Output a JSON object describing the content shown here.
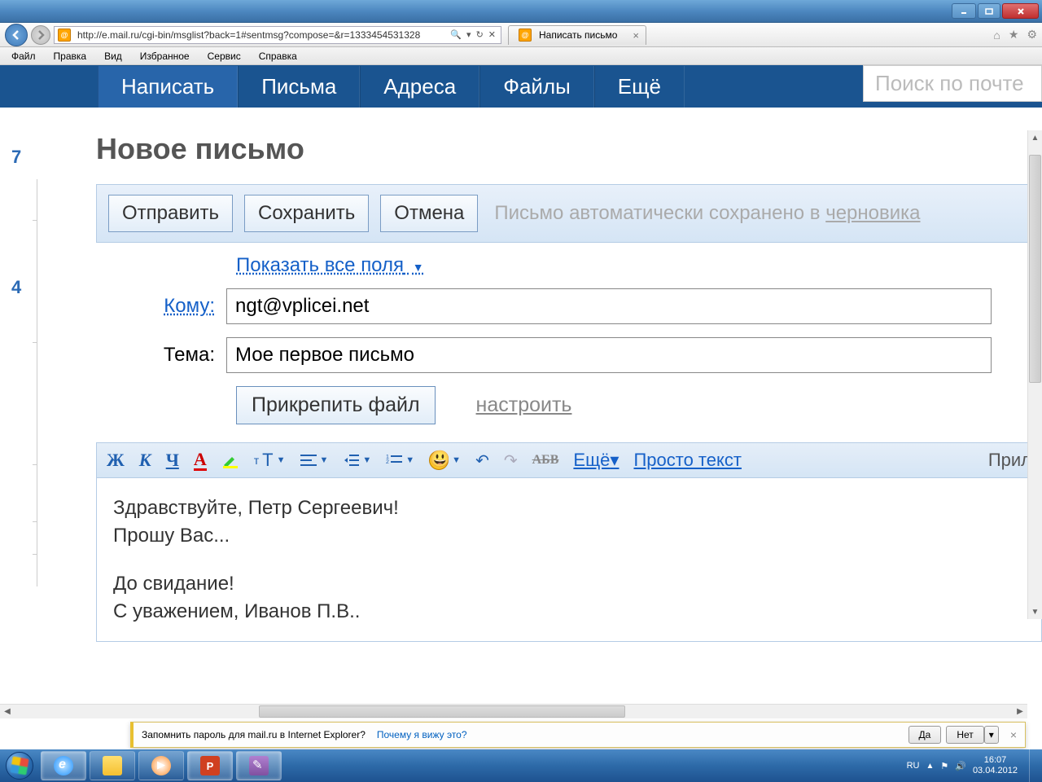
{
  "window": {
    "title": "Написать письмо"
  },
  "ie": {
    "url": "http://e.mail.ru/cgi-bin/msglist?back=1#sentmsg?compose=&r=1333454531328",
    "search_hint": "🔍 ▾ 🔒 ↻ ✕",
    "tab_title": "Написать письмо",
    "menu": [
      "Файл",
      "Правка",
      "Вид",
      "Избранное",
      "Сервис",
      "Справка"
    ]
  },
  "mailnav": {
    "items": [
      "Написать",
      "Письма",
      "Адреса",
      "Файлы",
      "Ещё"
    ],
    "search_placeholder": "Поиск по почте"
  },
  "sidebar": {
    "num1": "7",
    "num2": "4"
  },
  "compose": {
    "heading": "Новое письмо",
    "send": "Отправить",
    "save": "Сохранить",
    "cancel": "Отмена",
    "autosave": "Письмо автоматически сохранено в ",
    "autosave_link": "черновика",
    "show_all": "Показать все поля",
    "to_label": "Кому:",
    "to_value": "ngt@vplicei.net",
    "subj_label": "Тема:",
    "subj_value": "Мое первое письмо",
    "attach": "Прикрепить файл",
    "configure": "настроить"
  },
  "toolbar": {
    "bold": "Ж",
    "italic": "К",
    "underline": "Ч",
    "fontcolor": "A",
    "fontsize": "тТ",
    "strike": "АБВ",
    "more": "Ещё",
    "plaintext": "Просто текст",
    "right": "Прил"
  },
  "body": {
    "line1": "Здравствуйте, Петр Сергеевич!",
    "line2": "Прошу Вас...",
    "line3": "До свидание!",
    "line4": "С уважением, Иванов П.В.."
  },
  "pwbar": {
    "text": "Запомнить пароль для mail.ru в Internet Explorer?",
    "why": "Почему я вижу это?",
    "yes": "Да",
    "no": "Нет"
  },
  "systray": {
    "lang": "RU",
    "time": "16:07",
    "date": "03.04.2012"
  }
}
